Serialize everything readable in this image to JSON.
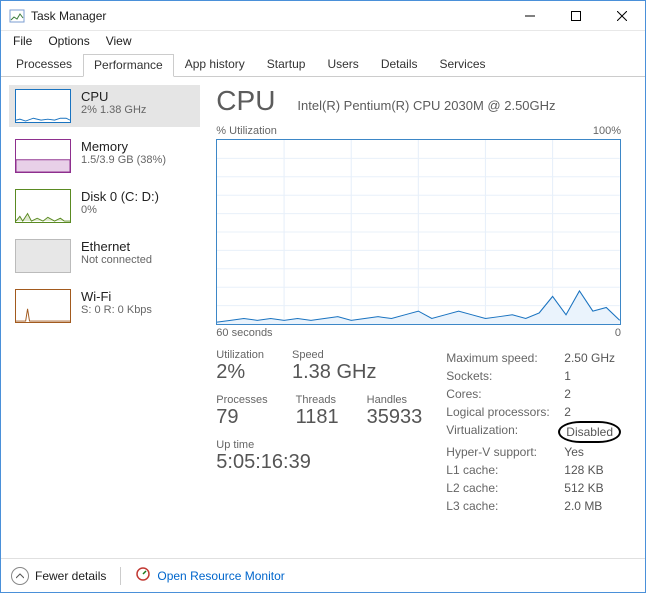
{
  "window": {
    "title": "Task Manager"
  },
  "menu": [
    "File",
    "Options",
    "View"
  ],
  "tabs": [
    {
      "label": "Processes"
    },
    {
      "label": "Performance",
      "active": true
    },
    {
      "label": "App history"
    },
    {
      "label": "Startup"
    },
    {
      "label": "Users"
    },
    {
      "label": "Details"
    },
    {
      "label": "Services"
    }
  ],
  "sidebar": [
    {
      "id": "cpu",
      "label": "CPU",
      "sub": "2%  1.38 GHz",
      "color": "#1a73c0",
      "selected": true
    },
    {
      "id": "memory",
      "label": "Memory",
      "sub": "1.5/3.9 GB (38%)",
      "color": "#8E2F8E"
    },
    {
      "id": "disk0",
      "label": "Disk 0 (C: D:)",
      "sub": "0%",
      "color": "#5a8a22"
    },
    {
      "id": "ethernet",
      "label": "Ethernet",
      "sub": "Not connected",
      "color": "#bbbbbb"
    },
    {
      "id": "wifi",
      "label": "Wi-Fi",
      "sub": "S: 0  R: 0 Kbps",
      "color": "#a25a1e"
    }
  ],
  "main": {
    "heading": "CPU",
    "cpu_name": "Intel(R) Pentium(R) CPU 2030M @ 2.50GHz",
    "chart_top_left": "% Utilization",
    "chart_top_right": "100%",
    "chart_bot_left": "60 seconds",
    "chart_bot_right": "0",
    "stats": {
      "utilization_label": "Utilization",
      "utilization": "2%",
      "speed_label": "Speed",
      "speed": "1.38 GHz",
      "processes_label": "Processes",
      "processes": "79",
      "threads_label": "Threads",
      "threads": "1181",
      "handles_label": "Handles",
      "handles": "35933",
      "uptime_label": "Up time",
      "uptime": "5:05:16:39"
    },
    "specs": [
      {
        "k": "Maximum speed:",
        "v": "2.50 GHz"
      },
      {
        "k": "Sockets:",
        "v": "1"
      },
      {
        "k": "Cores:",
        "v": "2"
      },
      {
        "k": "Logical processors:",
        "v": "2"
      },
      {
        "k": "Virtualization:",
        "v": "Disabled",
        "circled": true
      },
      {
        "k": "Hyper-V support:",
        "v": "Yes"
      },
      {
        "k": "L1 cache:",
        "v": "128 KB"
      },
      {
        "k": "L2 cache:",
        "v": "512 KB"
      },
      {
        "k": "L3 cache:",
        "v": "2.0 MB"
      }
    ]
  },
  "footer": {
    "fewer": "Fewer details",
    "orm": "Open Resource Monitor"
  },
  "colors": {
    "cpu_line": "#1a73c0",
    "cpu_fill": "#d4e7f6"
  },
  "chart_data": {
    "type": "line",
    "title": "% Utilization",
    "xlabel": "seconds ago",
    "ylabel": "% Utilization",
    "ylim": [
      0,
      100
    ],
    "xlim": [
      60,
      0
    ],
    "x": [
      60,
      58,
      56,
      54,
      52,
      50,
      48,
      46,
      44,
      42,
      40,
      38,
      36,
      34,
      32,
      30,
      28,
      26,
      24,
      22,
      20,
      18,
      16,
      14,
      12,
      10,
      8,
      6,
      4,
      2,
      0
    ],
    "values": [
      1,
      2,
      3,
      2,
      3,
      2,
      3,
      2,
      3,
      4,
      2,
      3,
      4,
      3,
      5,
      7,
      3,
      5,
      7,
      5,
      3,
      4,
      5,
      3,
      6,
      15,
      5,
      18,
      7,
      9,
      2
    ]
  }
}
